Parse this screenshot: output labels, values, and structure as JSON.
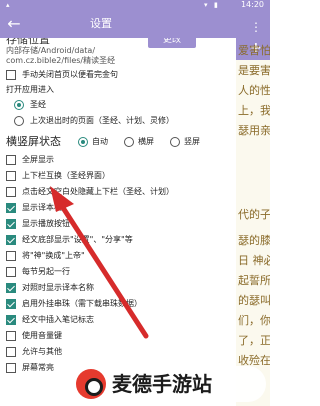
{
  "status_bar": {
    "time": "14:20"
  },
  "app_bar": {
    "title": "设置"
  },
  "storage": {
    "heading": "存储位置",
    "change_button": "更改",
    "path_lines": [
      "内部存储/Android/data/",
      "com.cz.bible2/files/精读圣经"
    ]
  },
  "options": {
    "manual_close_label": "手动关闭首页以便看完金句",
    "open_app_label": "打开应用进入",
    "radio_bible": "圣经",
    "radio_last_page": "上次退出时的页面（圣经、计划、灵修）"
  },
  "orientation": {
    "title": "横竖屏状态",
    "auto": "自动",
    "landscape": "横屏",
    "portrait": "竖屏"
  },
  "checkbox_items": [
    {
      "label": "全屏显示",
      "checked": false
    },
    {
      "label": "上下栏互换（圣经界面）",
      "checked": false
    },
    {
      "label": "点击经文空白处隐藏上下栏（圣经、计划）",
      "checked": false
    },
    {
      "label": "显示译本栏",
      "checked": true
    },
    {
      "label": "显示播放按钮",
      "checked": true
    },
    {
      "label": "经文底部显示\"设置\"、\"分享\"等",
      "checked": true
    },
    {
      "label": "将\"神\"换成\"上帝\"",
      "checked": false
    },
    {
      "label": "每节另起一行",
      "checked": false
    },
    {
      "label": "对照时显示译本名称",
      "checked": true
    },
    {
      "label": "启用外挂串珠（需下载串珠数据）",
      "checked": true
    },
    {
      "label": "经文中插入笔记标志",
      "checked": true
    },
    {
      "label": "使用音量键",
      "checked": false
    },
    {
      "label": "允许与其他",
      "checked": false
    },
    {
      "label": "屏幕常亮",
      "checked": false
    }
  ],
  "background_text": [
    "爱害怕，我",
    "是要害我,",
    "人的性命,",
    "上，我必养",
    "瑟用亲爱的",
    "代的子孙;",
    "瑟的膝上。",
    "日 神必定",
    "起誓所应许",
    "的瑟叫以色",
    "们，你们要",
    "了，正一",
    "收殓在棺材"
  ],
  "watermark": {
    "text": "麦德手游站"
  },
  "colors": {
    "accent": "#9c8fd0",
    "check": "#2a8a7e",
    "arrow": "#d62b2b"
  }
}
